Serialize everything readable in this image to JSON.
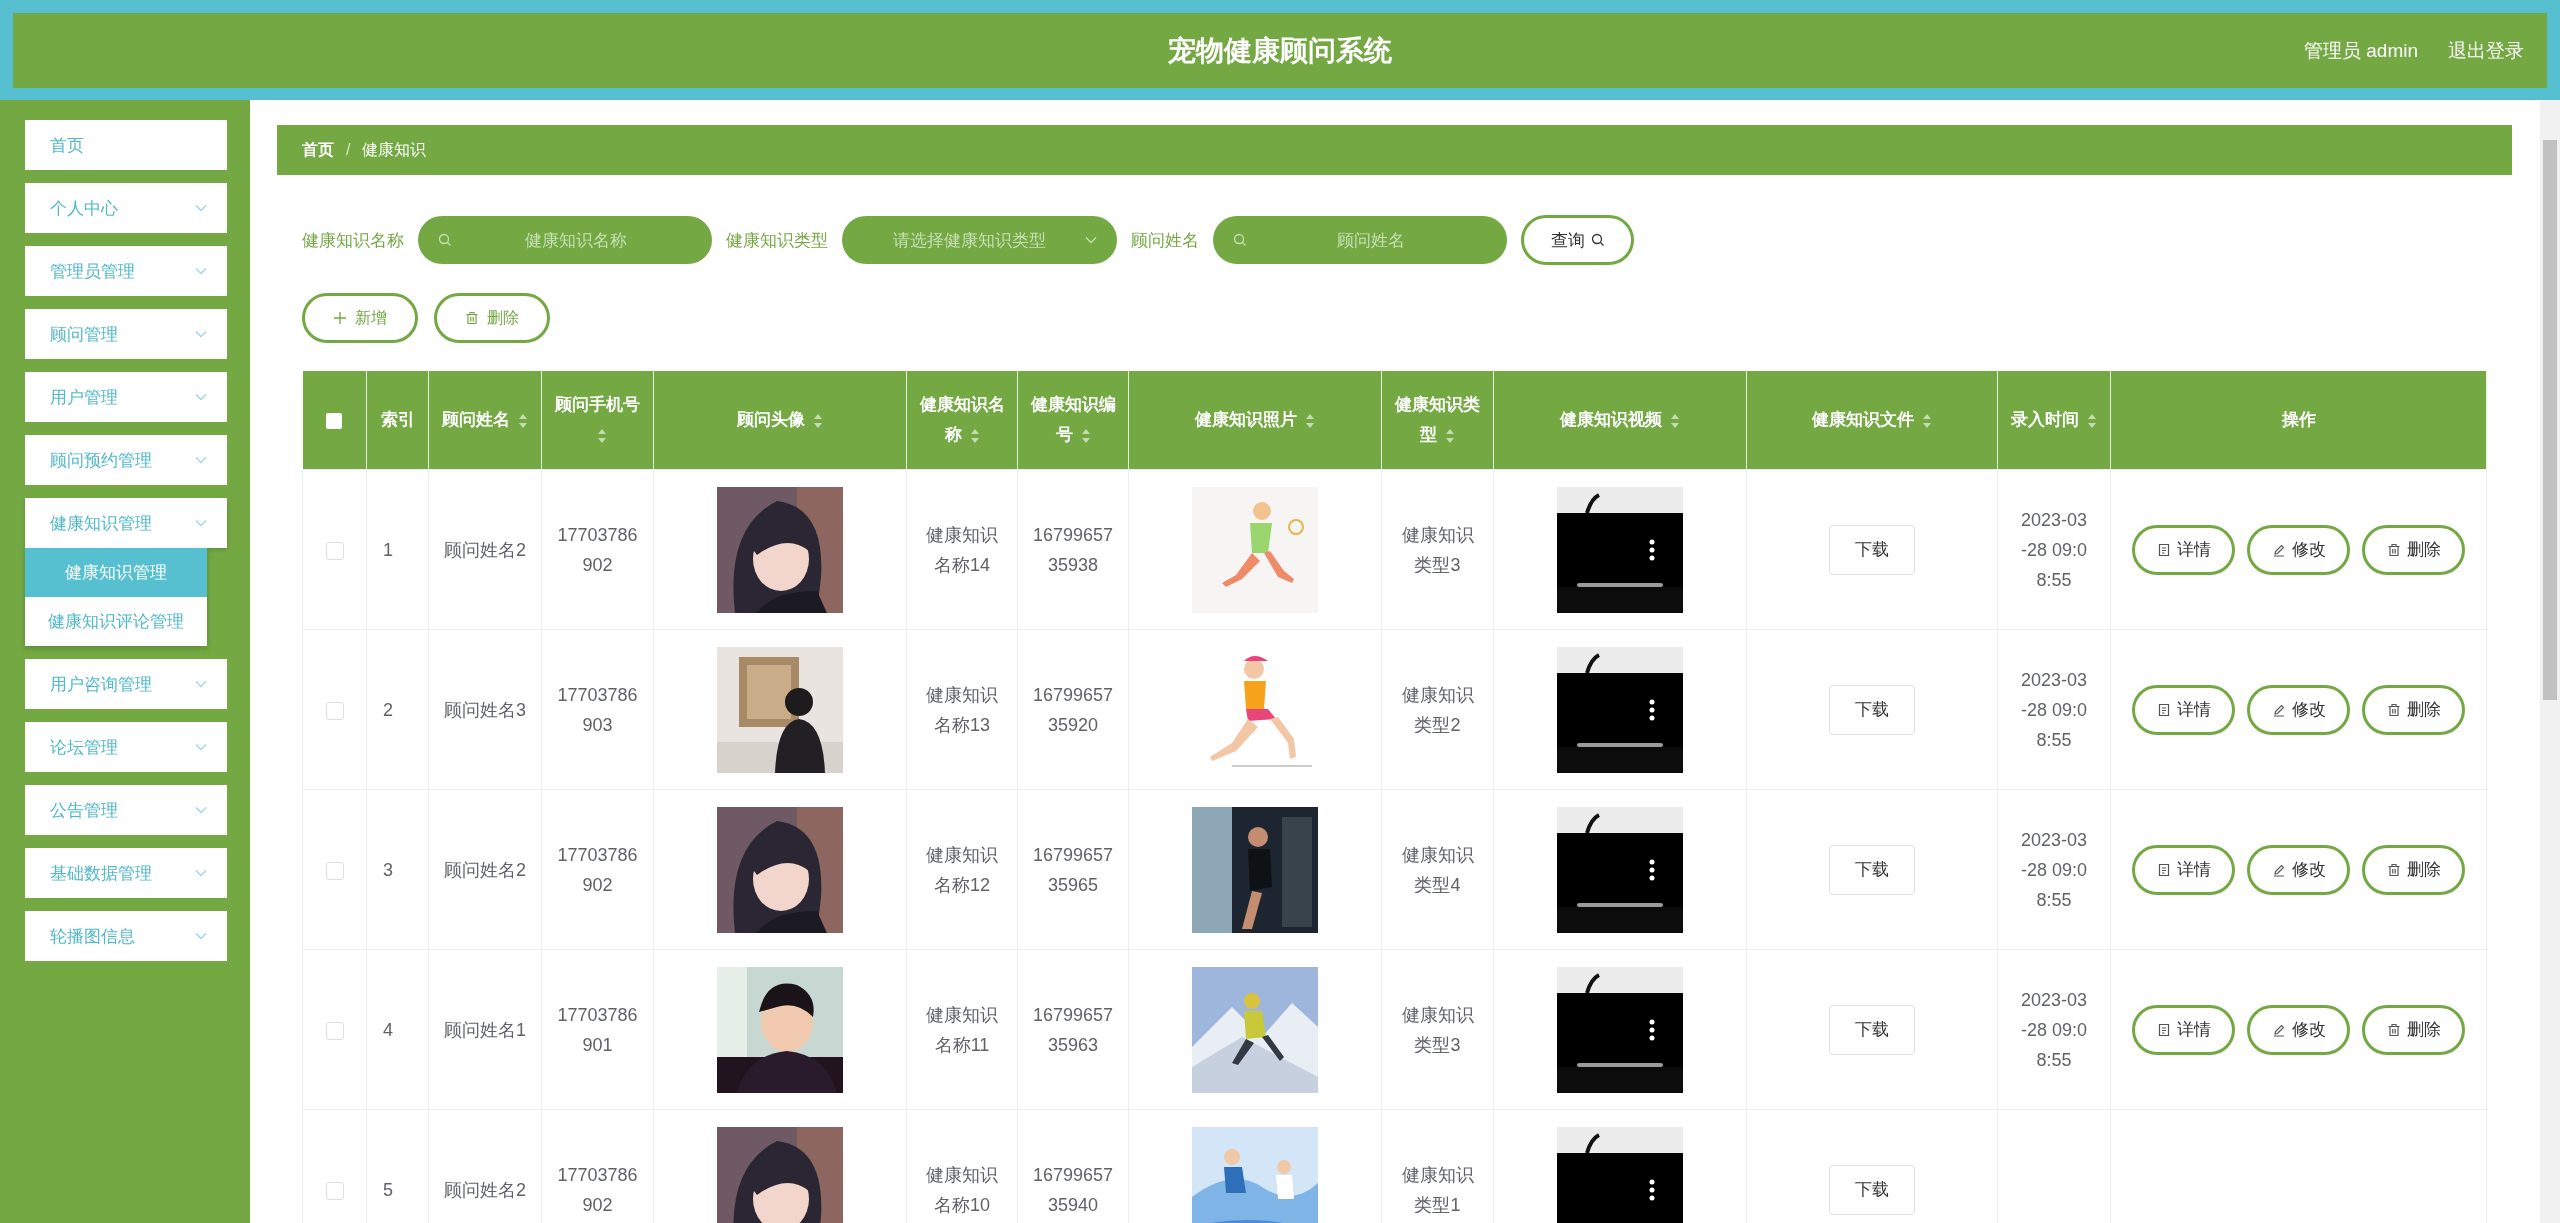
{
  "header": {
    "title": "宠物健康顾问系统",
    "user": "管理员 admin",
    "logout": "退出登录"
  },
  "sidebar": {
    "items": [
      {
        "label": "首页",
        "kind": "link",
        "expanded": false
      },
      {
        "label": "个人中心",
        "kind": "menu",
        "expanded": false
      },
      {
        "label": "管理员管理",
        "kind": "menu",
        "expanded": false
      },
      {
        "label": "顾问管理",
        "kind": "menu",
        "expanded": false
      },
      {
        "label": "用户管理",
        "kind": "menu",
        "expanded": false
      },
      {
        "label": "顾问预约管理",
        "kind": "menu",
        "expanded": false
      },
      {
        "label": "健康知识管理",
        "kind": "menu",
        "expanded": true,
        "children": [
          {
            "label": "健康知识管理",
            "selected": true
          },
          {
            "label": "健康知识评论管理",
            "selected": false
          }
        ]
      },
      {
        "label": "用户咨询管理",
        "kind": "menu",
        "expanded": false
      },
      {
        "label": "论坛管理",
        "kind": "menu",
        "expanded": false
      },
      {
        "label": "公告管理",
        "kind": "menu",
        "expanded": false
      },
      {
        "label": "基础数据管理",
        "kind": "menu",
        "expanded": false
      },
      {
        "label": "轮播图信息",
        "kind": "menu",
        "expanded": false
      }
    ]
  },
  "breadcrumb": [
    "首页",
    "健康知识"
  ],
  "breadcrumb_separator": "/",
  "filters": [
    {
      "label": "健康知识名称",
      "kind": "search",
      "placeholder": "健康知识名称"
    },
    {
      "label": "健康知识类型",
      "kind": "select",
      "placeholder": "请选择健康知识类型"
    },
    {
      "label": "顾问姓名",
      "kind": "search",
      "placeholder": "顾问姓名"
    }
  ],
  "search_button": "查询",
  "toolbar": [
    {
      "label": "新增",
      "kind": "add"
    },
    {
      "label": "删除",
      "kind": "delete"
    }
  ],
  "table": {
    "select_all_checked": false,
    "columns": [
      {
        "label": "索引",
        "sortable": false
      },
      {
        "label": "顾问姓名",
        "sortable": true
      },
      {
        "label": "顾问手机号",
        "sortable": true
      },
      {
        "label": "顾问头像",
        "sortable": true
      },
      {
        "label": "健康知识名称",
        "sortable": true
      },
      {
        "label": "健康知识编号",
        "sortable": true
      },
      {
        "label": "健康知识照片",
        "sortable": true
      },
      {
        "label": "健康知识类型",
        "sortable": true
      },
      {
        "label": "健康知识视频",
        "sortable": true
      },
      {
        "label": "健康知识文件",
        "sortable": true
      },
      {
        "label": "录入时间",
        "sortable": true
      },
      {
        "label": "操作",
        "sortable": false
      }
    ],
    "rows": [
      {
        "checked": false,
        "index": "1",
        "name": "顾问姓名2",
        "phone": "17703786902",
        "title": "健康知识名称14",
        "number": "1679965735938",
        "type": "健康知识类型3",
        "file_button": "下载",
        "time": "2023-03-28 09:08:55",
        "actions": [
          {
            "label": "详情",
            "kind": "detail"
          },
          {
            "label": "修改",
            "kind": "edit"
          },
          {
            "label": "删除",
            "kind": "delete"
          }
        ]
      },
      {
        "checked": false,
        "index": "2",
        "name": "顾问姓名3",
        "phone": "17703786903",
        "title": "健康知识名称13",
        "number": "1679965735920",
        "type": "健康知识类型2",
        "file_button": "下载",
        "time": "2023-03-28 09:08:55",
        "actions": [
          {
            "label": "详情",
            "kind": "detail"
          },
          {
            "label": "修改",
            "kind": "edit"
          },
          {
            "label": "删除",
            "kind": "delete"
          }
        ]
      },
      {
        "checked": false,
        "index": "3",
        "name": "顾问姓名2",
        "phone": "17703786902",
        "title": "健康知识名称12",
        "number": "1679965735965",
        "type": "健康知识类型4",
        "file_button": "下载",
        "time": "2023-03-28 09:08:55",
        "actions": [
          {
            "label": "详情",
            "kind": "detail"
          },
          {
            "label": "修改",
            "kind": "edit"
          },
          {
            "label": "删除",
            "kind": "delete"
          }
        ]
      },
      {
        "checked": false,
        "index": "4",
        "name": "顾问姓名1",
        "phone": "17703786901",
        "title": "健康知识名称11",
        "number": "1679965735963",
        "type": "健康知识类型3",
        "file_button": "下载",
        "time": "2023-03-28 09:08:55",
        "actions": [
          {
            "label": "详情",
            "kind": "detail"
          },
          {
            "label": "修改",
            "kind": "edit"
          },
          {
            "label": "删除",
            "kind": "delete"
          }
        ]
      },
      {
        "checked": false,
        "index": "5",
        "name": "顾问姓名2",
        "phone": "17703786902",
        "title": "健康知识名称10",
        "number": "1679965735940",
        "type": "健康知识类型1",
        "file_button": "下载"
      }
    ]
  }
}
